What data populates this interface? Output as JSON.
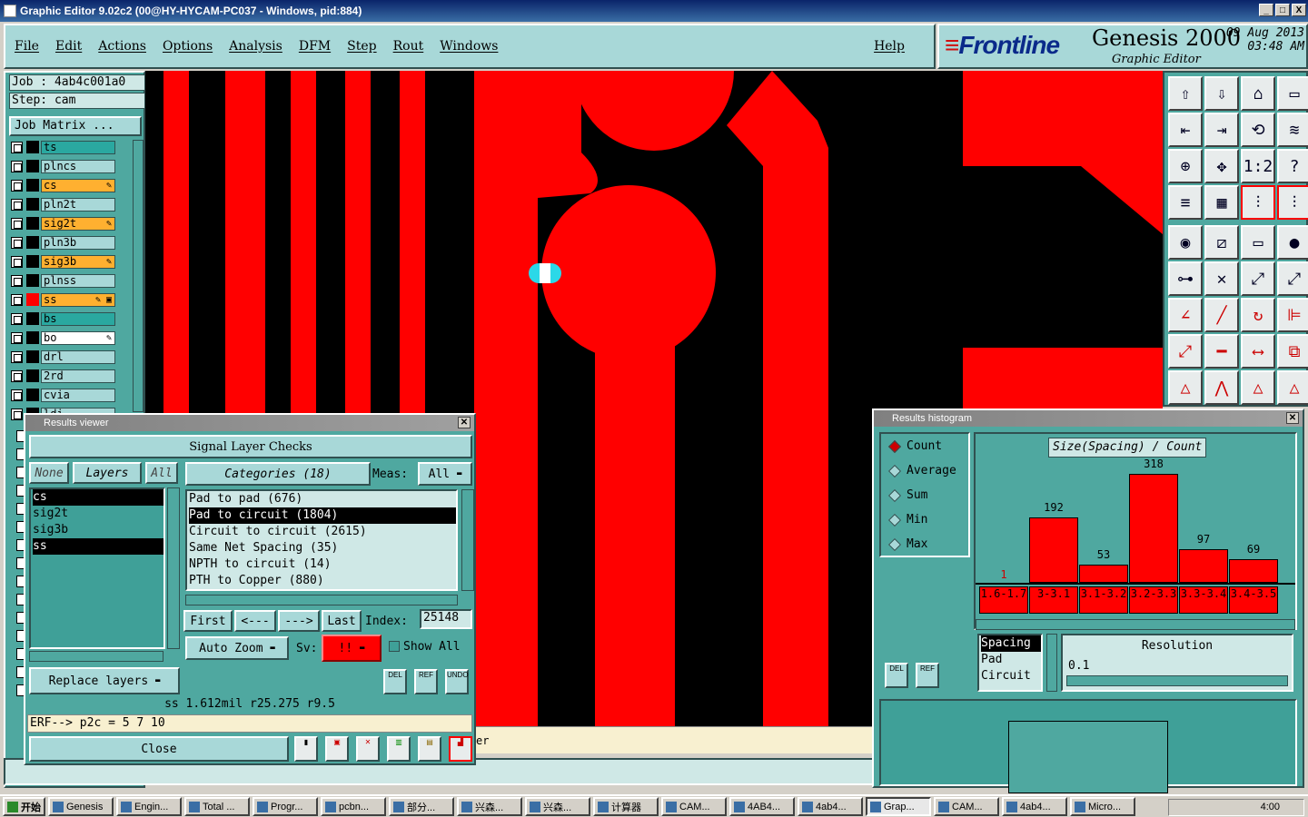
{
  "window": {
    "title": "Graphic Editor 9.02c2 (00@HY-HYCAM-PC037 - Windows, pid:884)",
    "min": "_",
    "max": "□",
    "close": "X"
  },
  "menu": {
    "items": [
      "File",
      "Edit",
      "Actions",
      "Options",
      "Analysis",
      "DFM",
      "Step",
      "Rout",
      "Windows"
    ],
    "help": "Help"
  },
  "brand": {
    "logo": "Frontline",
    "product": "Genesis 2000",
    "subtitle": "Graphic Editor",
    "date": "09 Aug 2013",
    "time": "03:48 AM"
  },
  "job": {
    "job": "Job : 4ab4c001a0",
    "step": "Step: cam",
    "matrix": "Job Matrix ..."
  },
  "layers": [
    {
      "name": "ts",
      "color": "#2aa8a0",
      "mark": ""
    },
    {
      "name": "plncs",
      "color": "#a8d8d8",
      "mark": ""
    },
    {
      "name": "cs",
      "color": "#ffb030",
      "mark": "✎"
    },
    {
      "name": "pln2t",
      "color": "#a8d8d8",
      "mark": ""
    },
    {
      "name": "sig2t",
      "color": "#ffb030",
      "mark": "✎"
    },
    {
      "name": "pln3b",
      "color": "#a8d8d8",
      "mark": ""
    },
    {
      "name": "sig3b",
      "color": "#ffb030",
      "mark": "✎"
    },
    {
      "name": "plnss",
      "color": "#a8d8d8",
      "mark": ""
    },
    {
      "name": "ss",
      "color": "#ffb030",
      "mark": "✎ ▣"
    },
    {
      "name": "bs",
      "color": "#2aa8a0",
      "mark": ""
    },
    {
      "name": "bo",
      "color": "#ffffff",
      "mark": "✎"
    },
    {
      "name": "drl",
      "color": "#a8d8d8",
      "mark": ""
    },
    {
      "name": "2rd",
      "color": "#a8d8d8",
      "mark": ""
    },
    {
      "name": "cvia",
      "color": "#a8d8d8",
      "mark": ""
    },
    {
      "name": "ldi",
      "color": "#a8d8d8",
      "mark": ""
    }
  ],
  "results": {
    "title": "Results viewer",
    "header": "Signal Layer Checks",
    "none": "None",
    "layers": "Layers",
    "all": "All",
    "categories": "Categories (18)",
    "meas_label": "Meas:",
    "meas_value": "All",
    "layer_list": [
      {
        "name": "cs",
        "sel": true
      },
      {
        "name": "sig2t",
        "sel": false
      },
      {
        "name": "sig3b",
        "sel": false
      },
      {
        "name": "ss",
        "sel": true
      }
    ],
    "cat_list": [
      {
        "name": "Pad to pad (676)",
        "sel": false
      },
      {
        "name": "Pad to circuit (1804)",
        "sel": true
      },
      {
        "name": "Circuit to circuit (2615)",
        "sel": false
      },
      {
        "name": "Same Net Spacing (35)",
        "sel": false
      },
      {
        "name": "NPTH to circuit (14)",
        "sel": false
      },
      {
        "name": "PTH to Copper (880)",
        "sel": false
      }
    ],
    "first": "First",
    "prev": "<---",
    "next": "--->",
    "last": "Last",
    "index_label": "Index:",
    "index_value": "25148",
    "auto_zoom": "Auto Zoom",
    "sv_label": "Sv:",
    "sv_value": "!!",
    "show_all": "Show All",
    "replace_layers": "Replace layers",
    "status": "ss 1.612mil  r25.275  r9.5",
    "erf": "ERF--> p2c = 5 7 10",
    "close": "Close",
    "del": "DEL",
    "ref": "REF",
    "undo": "UNDO"
  },
  "histogram": {
    "title": "Results histogram",
    "modes": [
      {
        "name": "Count",
        "on": true
      },
      {
        "name": "Average",
        "on": false
      },
      {
        "name": "Sum",
        "on": false
      },
      {
        "name": "Min",
        "on": false
      },
      {
        "name": "Max",
        "on": false
      }
    ],
    "chart_title": "Size(Spacing) / Count",
    "resolution_label": "Resolution",
    "resolution_value": "0.1",
    "measure_list": [
      {
        "name": "Spacing",
        "sel": true
      },
      {
        "name": "Pad",
        "sel": false
      },
      {
        "name": "Circuit",
        "sel": false
      }
    ],
    "del": "DEL",
    "ref": "REF"
  },
  "chart_data": {
    "type": "bar",
    "title": "Size(Spacing) / Count",
    "categories": [
      "1.6-1.7",
      "3-3.1",
      "3.1-3.2",
      "3.2-3.3",
      "3.3-3.4",
      "3.4-3.5"
    ],
    "values": [
      1,
      192,
      53,
      318,
      97,
      69
    ],
    "ylim": [
      0,
      318
    ]
  },
  "canvas_note_text": "er",
  "taskbar": {
    "start": "开始",
    "tasks": [
      "Genesis",
      "Engin...",
      "Total ...",
      "Progr...",
      "pcbn...",
      "部分...",
      "兴森...",
      "兴森...",
      "计算器",
      "CAM...",
      "4AB4...",
      "4ab4...",
      "Grap...",
      "CAM...",
      "4ab4...",
      "Micro..."
    ],
    "clock": "4:00"
  }
}
